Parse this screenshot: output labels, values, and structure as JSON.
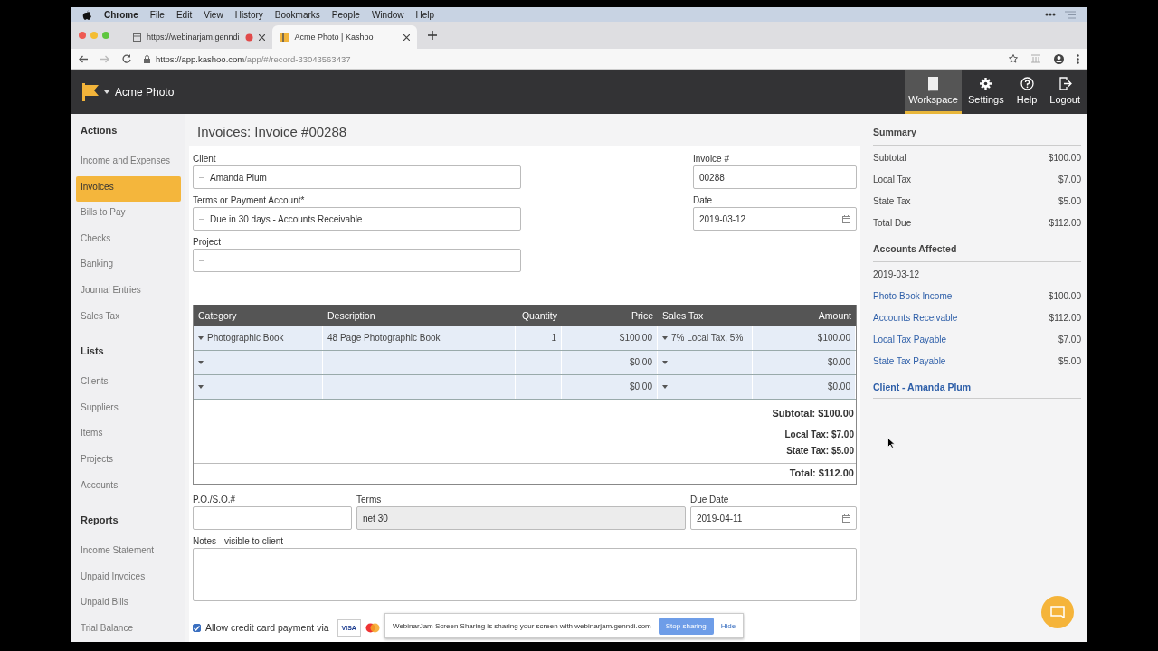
{
  "menu_bar": {
    "app": "Chrome",
    "items": [
      "File",
      "Edit",
      "View",
      "History",
      "Bookmarks",
      "People",
      "Window",
      "Help"
    ]
  },
  "browser_tabs": [
    {
      "title": "https://webinarjam.genndi",
      "selected": false,
      "recording": true
    },
    {
      "title": "Acme Photo | Kashoo",
      "selected": true,
      "recording": false
    }
  ],
  "address_bar": {
    "host": "https://app.kashoo.com",
    "path": "/app/#/record-33043563437"
  },
  "header": {
    "company": "Acme Photo",
    "nav": [
      {
        "kind": "workspace",
        "label": "Workspace",
        "selected": true
      },
      {
        "kind": "settings",
        "label": "Settings",
        "selected": false
      },
      {
        "kind": "help",
        "label": "Help",
        "selected": false
      },
      {
        "kind": "logout",
        "label": "Logout",
        "selected": false
      }
    ]
  },
  "sidebar": [
    {
      "heading": "Actions",
      "items": [
        {
          "label": "Income and Expenses",
          "selected": false
        },
        {
          "label": "Invoices",
          "selected": true
        },
        {
          "label": "Bills to Pay",
          "selected": false
        },
        {
          "label": "Checks",
          "selected": false
        },
        {
          "label": "Banking",
          "selected": false
        },
        {
          "label": "Journal Entries",
          "selected": false
        },
        {
          "label": "Sales Tax",
          "selected": false
        }
      ]
    },
    {
      "heading": "Lists",
      "items": [
        {
          "label": "Clients",
          "selected": false
        },
        {
          "label": "Suppliers",
          "selected": false
        },
        {
          "label": "Items",
          "selected": false
        },
        {
          "label": "Projects",
          "selected": false
        },
        {
          "label": "Accounts",
          "selected": false
        }
      ]
    },
    {
      "heading": "Reports",
      "items": [
        {
          "label": "Income Statement",
          "selected": false
        },
        {
          "label": "Unpaid Invoices",
          "selected": false
        },
        {
          "label": "Unpaid Bills",
          "selected": false
        },
        {
          "label": "Trial Balance",
          "selected": false
        }
      ]
    }
  ],
  "invoice": {
    "title": "Invoices: Invoice #00288",
    "left_fields": [
      {
        "label": "Client",
        "value": "Amanda Plum"
      },
      {
        "label": "Terms or Payment Account*",
        "value": "Due in 30 days - Accounts Receivable"
      },
      {
        "label": "Project"
      }
    ],
    "right_fields": [
      {
        "label": "Invoice #",
        "value": "00288",
        "kind": "text"
      },
      {
        "label": "Date",
        "value": "2019-03-12",
        "kind": "date"
      }
    ],
    "table": {
      "columns": [
        "Category",
        "Description",
        "Quantity",
        "Price",
        "Sales Tax",
        "Amount"
      ],
      "rows": [
        {
          "category": "Photographic Book",
          "description": "48 Page Photographic Book",
          "quantity": "1",
          "price": "$100.00",
          "sales_tax": "7% Local Tax, 5%",
          "amount": "$100.00"
        },
        {
          "price": "$0.00",
          "amount": "$0.00"
        },
        {
          "price": "$0.00",
          "amount": "$0.00"
        }
      ],
      "subtotal": "Subtotal: $100.00",
      "taxes": [
        "Local Tax: $7.00",
        "State Tax: $5.00"
      ],
      "total": "Total: $112.00"
    },
    "po": {
      "label": "P.O./S.O.#"
    },
    "terms": {
      "label": "Terms",
      "value": "net 30",
      "disabled": true
    },
    "due_date": {
      "label": "Due Date",
      "value": "2019-04-11"
    },
    "notes": {
      "label": "Notes - visible to client"
    },
    "credit_card": {
      "label": "Allow credit card payment via",
      "checked": true,
      "card_text": "VISA"
    }
  },
  "summary": {
    "heading": "Summary",
    "rows": [
      {
        "label": "Subtotal",
        "value": "$100.00"
      },
      {
        "label": "Local Tax",
        "value": "$7.00"
      },
      {
        "label": "State Tax",
        "value": "$5.00"
      },
      {
        "label": "Total Due",
        "value": "$112.00"
      }
    ],
    "accounts_heading": "Accounts Affected",
    "date": "2019-03-12",
    "accounts": [
      {
        "label": "Photo Book Income",
        "value": "$100.00"
      },
      {
        "label": "Accounts Receivable",
        "value": "$112.00"
      },
      {
        "label": "Local Tax Payable",
        "value": "$7.00"
      },
      {
        "label": "State Tax Payable",
        "value": "$5.00"
      }
    ],
    "client_prefix": "Client - ",
    "client_name": "Amanda Plum"
  },
  "share_bar": {
    "message": "WebinarJam Screen Sharing is sharing your screen with webinarjam.genndi.com",
    "stop": "Stop sharing",
    "hide": "Hide"
  }
}
